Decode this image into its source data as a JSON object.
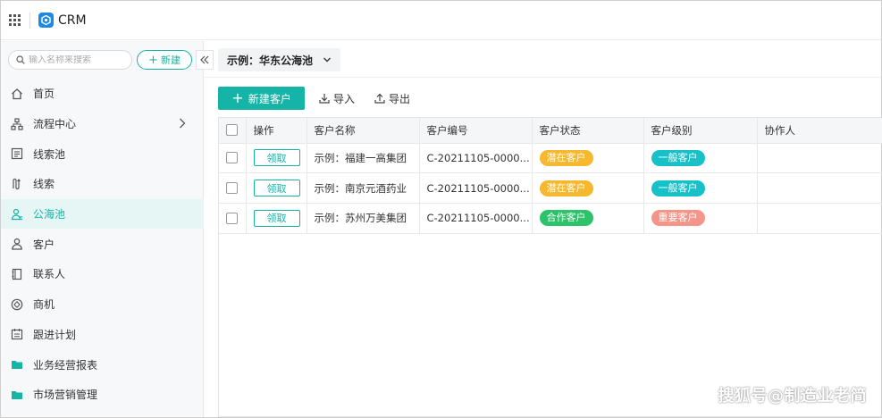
{
  "app": {
    "title": "CRM",
    "brand_color": "#1e88e5",
    "accent_color": "#16b4a6"
  },
  "sidebar": {
    "search_placeholder": "输入名称来搜索",
    "new_label": "新建",
    "items": [
      {
        "label": "首页",
        "icon": "home-icon"
      },
      {
        "label": "流程中心",
        "icon": "flow-icon",
        "has_submenu": true
      },
      {
        "label": "线索池",
        "icon": "lead-pool-icon"
      },
      {
        "label": "线索",
        "icon": "lead-icon"
      },
      {
        "label": "公海池",
        "icon": "public-pool-icon",
        "active": true
      },
      {
        "label": "客户",
        "icon": "customer-icon"
      },
      {
        "label": "联系人",
        "icon": "contact-icon"
      },
      {
        "label": "商机",
        "icon": "opportunity-icon"
      },
      {
        "label": "跟进计划",
        "icon": "calendar-icon"
      },
      {
        "label": "业务经营报表",
        "icon": "folder-icon"
      },
      {
        "label": "市场营销管理",
        "icon": "folder-icon"
      }
    ]
  },
  "toolbar": {
    "view_name": "示例：华东公海池",
    "add_customer_label": "新建客户",
    "import_label": "导入",
    "export_label": "导出"
  },
  "table": {
    "columns": [
      "操作",
      "客户名称",
      "客户编号",
      "客户状态",
      "客户级别",
      "协作人"
    ],
    "rows": [
      {
        "action": "领取",
        "name": "示例：福建一高集团",
        "code": "C-20211105-0000...",
        "status": "潜在客户",
        "status_color": "#f5b82e",
        "level": "一般客户",
        "level_color": "#17c1c8",
        "collaborator": ""
      },
      {
        "action": "领取",
        "name": "示例：南京元酒药业",
        "code": "C-20211105-0000...",
        "status": "潜在客户",
        "status_color": "#f5b82e",
        "level": "一般客户",
        "level_color": "#17c1c8",
        "collaborator": ""
      },
      {
        "action": "领取",
        "name": "示例：苏州万美集团",
        "code": "C-20211105-0000...",
        "status": "合作客户",
        "status_color": "#2dc36a",
        "level": "重要客户",
        "level_color": "#f5958a",
        "collaborator": ""
      }
    ]
  },
  "watermark": "搜狐号@制造业老简"
}
